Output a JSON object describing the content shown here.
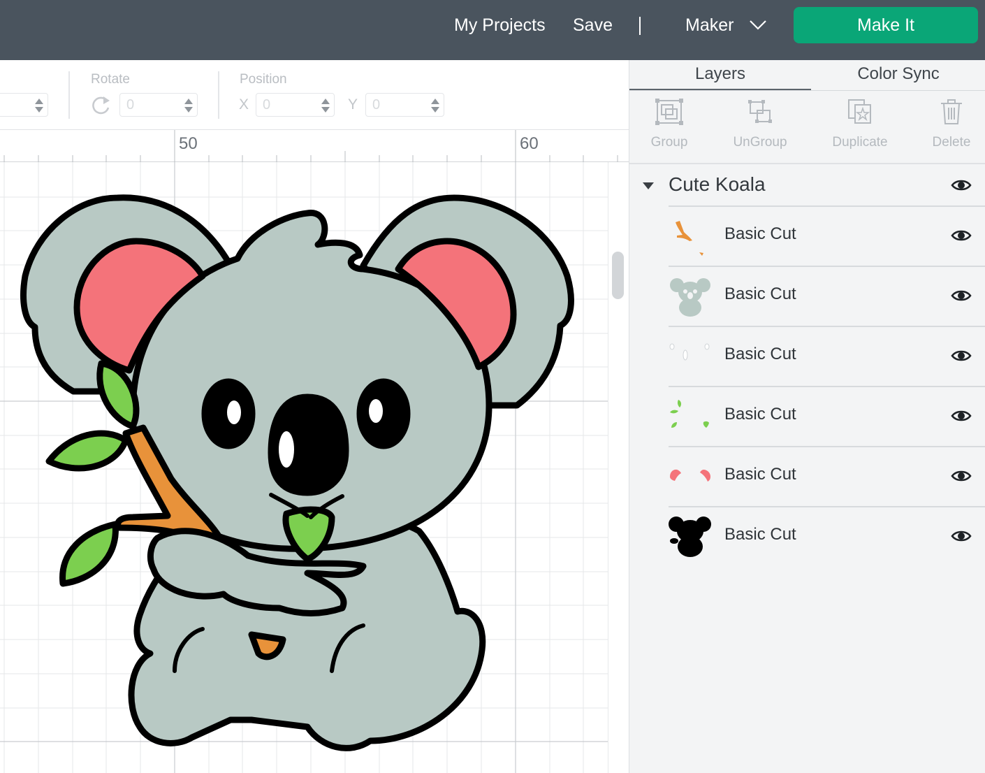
{
  "header": {
    "my_projects": "My Projects",
    "save": "Save",
    "machine": "Maker",
    "make_it": "Make It",
    "accent_color": "#0aa677"
  },
  "toolbar": {
    "size_value": "",
    "rotate_label": "Rotate",
    "rotate_value": "0",
    "position_label": "Position",
    "x_label": "X",
    "x_value": "0",
    "y_label": "Y",
    "y_value": "0"
  },
  "ruler": {
    "marks": [
      "50",
      "60"
    ]
  },
  "panel": {
    "tabs": [
      {
        "label": "Layers",
        "active": true
      },
      {
        "label": "Color Sync",
        "active": false
      }
    ],
    "tools": [
      {
        "label": "Group",
        "icon": "group-icon"
      },
      {
        "label": "UnGroup",
        "icon": "ungroup-icon"
      },
      {
        "label": "Duplicate",
        "icon": "duplicate-icon"
      },
      {
        "label": "Delete",
        "icon": "trash-icon"
      }
    ],
    "group_name": "Cute Koala",
    "layers": [
      {
        "label": "Basic Cut",
        "thumb": "branch",
        "color": "#e8923a"
      },
      {
        "label": "Basic Cut",
        "thumb": "koala-body",
        "color": "#b8c9c4"
      },
      {
        "label": "Basic Cut",
        "thumb": "eye-highlights",
        "color": "#ffffff"
      },
      {
        "label": "Basic Cut",
        "thumb": "leaves",
        "color": "#7ccf4f"
      },
      {
        "label": "Basic Cut",
        "thumb": "ears",
        "color": "#f4737a"
      },
      {
        "label": "Basic Cut",
        "thumb": "outline",
        "color": "#000000"
      }
    ]
  },
  "colors": {
    "body": "#b8c9c4",
    "ear": "#f4737a",
    "leaf": "#7ccf4f",
    "branch": "#e8923a",
    "outline": "#000000"
  }
}
